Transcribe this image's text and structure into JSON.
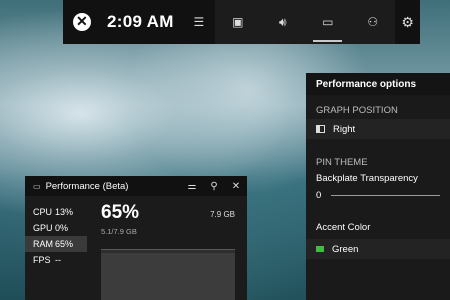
{
  "gamebar": {
    "time": "2:09 AM",
    "icons": [
      "xbox-logo",
      "menu-icon",
      "capture-icon",
      "audio-icon",
      "performance-icon",
      "social-icon",
      "gear-icon"
    ]
  },
  "performance_options": {
    "title": "Performance options",
    "graph_position_label": "GRAPH POSITION",
    "graph_position_value": "Right",
    "pin_theme_label": "PIN THEME",
    "backplate_label": "Backplate Transparency",
    "backplate_value": "0",
    "accent_label": "Accent Color",
    "accent_value": "Green",
    "accent_color": "#3fbf3f"
  },
  "performance_widget": {
    "title": "Performance (Beta)",
    "stats": [
      {
        "name": "CPU",
        "value": "13%"
      },
      {
        "name": "GPU",
        "value": "0%"
      },
      {
        "name": "RAM",
        "value": "65%"
      },
      {
        "name": "FPS",
        "value": "--"
      }
    ],
    "selected_pct": "65%",
    "total": "7.9 GB",
    "used": "5.1/7.9 GB"
  }
}
